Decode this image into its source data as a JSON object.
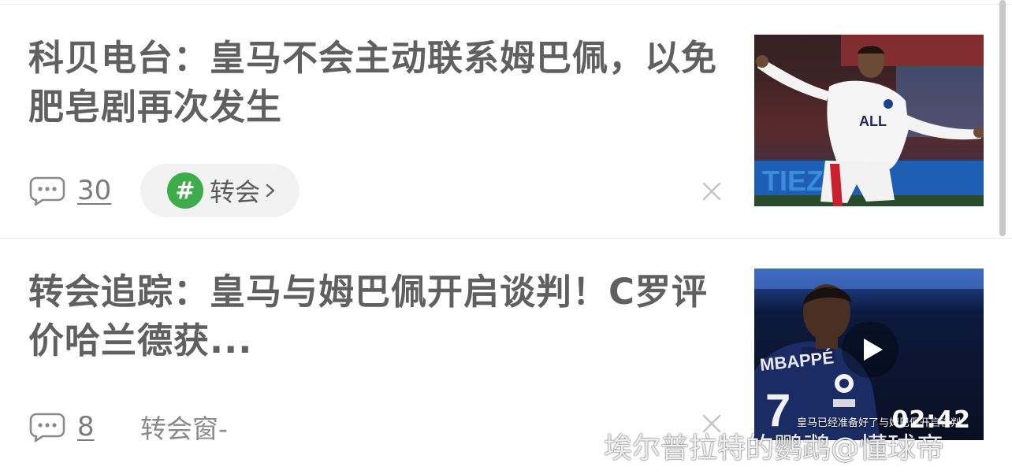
{
  "feed": {
    "items": [
      {
        "title": "科贝电台：皇马不会主动联系姆巴佩，以免肥皂剧再次发生",
        "comment_count": "30",
        "tag": {
          "symbol": "#",
          "label": "转会",
          "arrow": "›"
        },
        "thumbnail_icon": "photo-mbappe-celebration",
        "close_icon": "close-icon"
      },
      {
        "title": "转会追踪：皇马与姆巴佩开启谈判！C罗评价哈兰德获...",
        "comment_count": "8",
        "source": "转会窗-",
        "video": {
          "duration": "02:42",
          "caption": "皇马已经准备好了与姆巴佩开启谈判"
        },
        "thumbnail_icon": "video-mbappe-portrait",
        "close_icon": "close-icon"
      }
    ]
  },
  "watermark": "埃尔普拉特的鹦鹉@懂球帝",
  "colors": {
    "title": "#606060",
    "meta": "#7b7b7b",
    "tag_background": "#f2f2f2",
    "hash_green": "#3dad4c",
    "divider": "#e6e6e6"
  }
}
